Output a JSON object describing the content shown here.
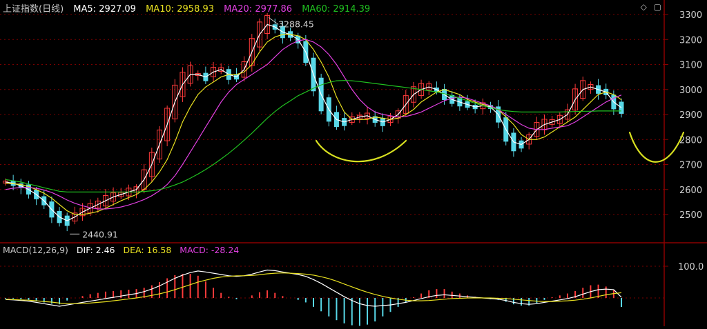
{
  "header": {
    "title": "上证指数(日线)",
    "ma5": "MA5: 2927.09",
    "ma10": "MA10: 2958.93",
    "ma20": "MA20: 2977.86",
    "ma60": "MA60: 2914.39"
  },
  "macd_header": {
    "title": "MACD(12,26,9)",
    "dif": "DIF: 2.46",
    "dea": "DEA: 16.58",
    "macd": "MACD: -28.24"
  },
  "annotations": {
    "high": "3288.45",
    "low": "2440.91"
  },
  "icons": [
    "diamond-icon",
    "maximize-icon"
  ],
  "colors": {
    "background": "#000000",
    "axis": "#8b0000",
    "up": "#ff3b3b",
    "down": "#58d8e8",
    "ma5": "#ffffff",
    "ma10": "#e8e020",
    "ma20": "#e040e0",
    "ma60": "#20c020",
    "marker": "#d8e020"
  },
  "chart_data": [
    {
      "type": "candlestick",
      "title": "上证指数(日线)",
      "ylim": [
        2400,
        3330
      ],
      "yticks": [
        2500,
        2600,
        2700,
        2800,
        2900,
        3000,
        3100,
        3200,
        3300
      ],
      "grid": true,
      "series": [
        {
          "name": "MA5",
          "values": [
            2630,
            2625,
            2615,
            2600,
            2580,
            2555,
            2520,
            2490,
            2475,
            2490,
            2510,
            2525,
            2540,
            2555,
            2570,
            2580,
            2590,
            2600,
            2640,
            2700,
            2780,
            2860,
            2950,
            3020,
            3060,
            3060,
            3050,
            3070,
            3080,
            3060,
            3050,
            3080,
            3150,
            3220,
            3260,
            3250,
            3230,
            3220,
            3200,
            3150,
            3060,
            2980,
            2920,
            2880,
            2870,
            2880,
            2890,
            2895,
            2880,
            2870,
            2880,
            2900,
            2940,
            2980,
            3000,
            3010,
            3000,
            2980,
            2960,
            2950,
            2940,
            2930,
            2935,
            2930,
            2900,
            2840,
            2790,
            2780,
            2800,
            2840,
            2860,
            2870,
            2880,
            2900,
            2960,
            3000,
            3010,
            3000,
            2990,
            2950,
            2927
          ]
        },
        {
          "name": "MA10",
          "values": [
            2625,
            2623,
            2620,
            2612,
            2600,
            2585,
            2565,
            2540,
            2515,
            2500,
            2500,
            2505,
            2512,
            2525,
            2540,
            2555,
            2568,
            2580,
            2600,
            2630,
            2670,
            2720,
            2790,
            2870,
            2930,
            2980,
            3010,
            3030,
            3050,
            3060,
            3060,
            3070,
            3100,
            3150,
            3190,
            3210,
            3220,
            3220,
            3215,
            3200,
            3160,
            3110,
            3050,
            2970,
            2910,
            2880,
            2880,
            2880,
            2890,
            2885,
            2880,
            2885,
            2900,
            2920,
            2950,
            2970,
            2990,
            3000,
            2990,
            2980,
            2960,
            2950,
            2940,
            2935,
            2920,
            2890,
            2860,
            2820,
            2800,
            2800,
            2810,
            2830,
            2850,
            2870,
            2890,
            2920,
            2950,
            2980,
            2990,
            2980,
            2959
          ]
        },
        {
          "name": "MA20",
          "values": [
            2600,
            2605,
            2608,
            2608,
            2605,
            2598,
            2588,
            2574,
            2558,
            2545,
            2535,
            2527,
            2522,
            2522,
            2525,
            2530,
            2538,
            2548,
            2560,
            2575,
            2595,
            2620,
            2655,
            2700,
            2750,
            2800,
            2850,
            2900,
            2950,
            2990,
            3020,
            3040,
            3060,
            3080,
            3100,
            3130,
            3160,
            3180,
            3195,
            3200,
            3190,
            3170,
            3140,
            3100,
            3050,
            3000,
            2960,
            2930,
            2910,
            2900,
            2895,
            2890,
            2892,
            2900,
            2910,
            2925,
            2940,
            2955,
            2965,
            2970,
            2965,
            2955,
            2945,
            2935,
            2920,
            2900,
            2880,
            2860,
            2845,
            2840,
            2840,
            2845,
            2850,
            2855,
            2870,
            2890,
            2910,
            2930,
            2950,
            2965,
            2978
          ]
        },
        {
          "name": "MA60",
          "values": [
            2640,
            2635,
            2630,
            2622,
            2615,
            2607,
            2600,
            2593,
            2590,
            2590,
            2590,
            2590,
            2590,
            2590,
            2590,
            2590,
            2590,
            2590,
            2592,
            2595,
            2600,
            2608,
            2618,
            2630,
            2645,
            2662,
            2680,
            2700,
            2722,
            2745,
            2770,
            2797,
            2825,
            2855,
            2885,
            2912,
            2935,
            2955,
            2975,
            2990,
            3005,
            3018,
            3028,
            3035,
            3036,
            3035,
            3032,
            3028,
            3024,
            3020,
            3016,
            3012,
            3008,
            3004,
            3000,
            2995,
            2990,
            2983,
            2975,
            2965,
            2955,
            2945,
            2935,
            2927,
            2920,
            2915,
            2912,
            2910,
            2910,
            2910,
            2910,
            2910,
            2910,
            2911,
            2912,
            2913,
            2913,
            2914,
            2914,
            2914,
            2914
          ]
        }
      ],
      "annotations": [
        {
          "label": "3288.45",
          "type": "high"
        },
        {
          "label": "2440.91",
          "type": "low"
        }
      ]
    },
    {
      "type": "bar",
      "title": "MACD(12,26,9)",
      "ylim": [
        -50,
        140
      ],
      "yticks": [
        100
      ],
      "series": [
        {
          "name": "DIF",
          "values": [
            -5,
            -6,
            -8,
            -10,
            -14,
            -18,
            -22,
            -26,
            -22,
            -18,
            -14,
            -10,
            -6,
            -2,
            2,
            6,
            10,
            14,
            20,
            28,
            38,
            50,
            62,
            72,
            80,
            85,
            82,
            78,
            74,
            70,
            68,
            70,
            75,
            82,
            88,
            86,
            82,
            78,
            74,
            68,
            58,
            46,
            32,
            18,
            4,
            -8,
            -18,
            -24,
            -26,
            -24,
            -22,
            -18,
            -14,
            -8,
            -2,
            4,
            8,
            10,
            8,
            6,
            4,
            2,
            0,
            -2,
            -4,
            -8,
            -14,
            -18,
            -20,
            -18,
            -14,
            -10,
            -6,
            -2,
            4,
            12,
            20,
            26,
            28,
            26,
            2.46
          ]
        },
        {
          "name": "DEA",
          "values": [
            -4,
            -5,
            -6,
            -7,
            -9,
            -11,
            -13,
            -16,
            -18,
            -18,
            -17,
            -16,
            -14,
            -12,
            -9,
            -6,
            -3,
            0,
            4,
            8,
            13,
            19,
            26,
            34,
            42,
            50,
            56,
            62,
            66,
            68,
            70,
            70,
            71,
            73,
            76,
            78,
            79,
            78,
            77,
            75,
            72,
            67,
            61,
            53,
            44,
            35,
            26,
            18,
            11,
            5,
            0,
            -4,
            -7,
            -9,
            -9,
            -8,
            -6,
            -4,
            -2,
            -1,
            0,
            0,
            0,
            0,
            -1,
            -2,
            -4,
            -6,
            -8,
            -10,
            -11,
            -11,
            -10,
            -9,
            -7,
            -4,
            0,
            5,
            10,
            14,
            16.58
          ]
        },
        {
          "name": "MACD",
          "values": [
            -2,
            -2,
            -4,
            -6,
            -10,
            -14,
            -18,
            -20,
            -8,
            0,
            6,
            12,
            16,
            20,
            22,
            24,
            26,
            28,
            32,
            40,
            50,
            62,
            72,
            76,
            76,
            70,
            52,
            32,
            16,
            4,
            -4,
            0,
            8,
            18,
            24,
            16,
            6,
            0,
            -6,
            -14,
            -28,
            -42,
            -58,
            -70,
            -80,
            -86,
            -88,
            -84,
            -74,
            -58,
            -44,
            -28,
            -14,
            2,
            14,
            24,
            28,
            28,
            20,
            14,
            8,
            4,
            0,
            -4,
            -6,
            -12,
            -20,
            -24,
            -24,
            -16,
            -6,
            2,
            8,
            14,
            22,
            32,
            40,
            42,
            36,
            24,
            -28.24
          ]
        }
      ]
    }
  ]
}
